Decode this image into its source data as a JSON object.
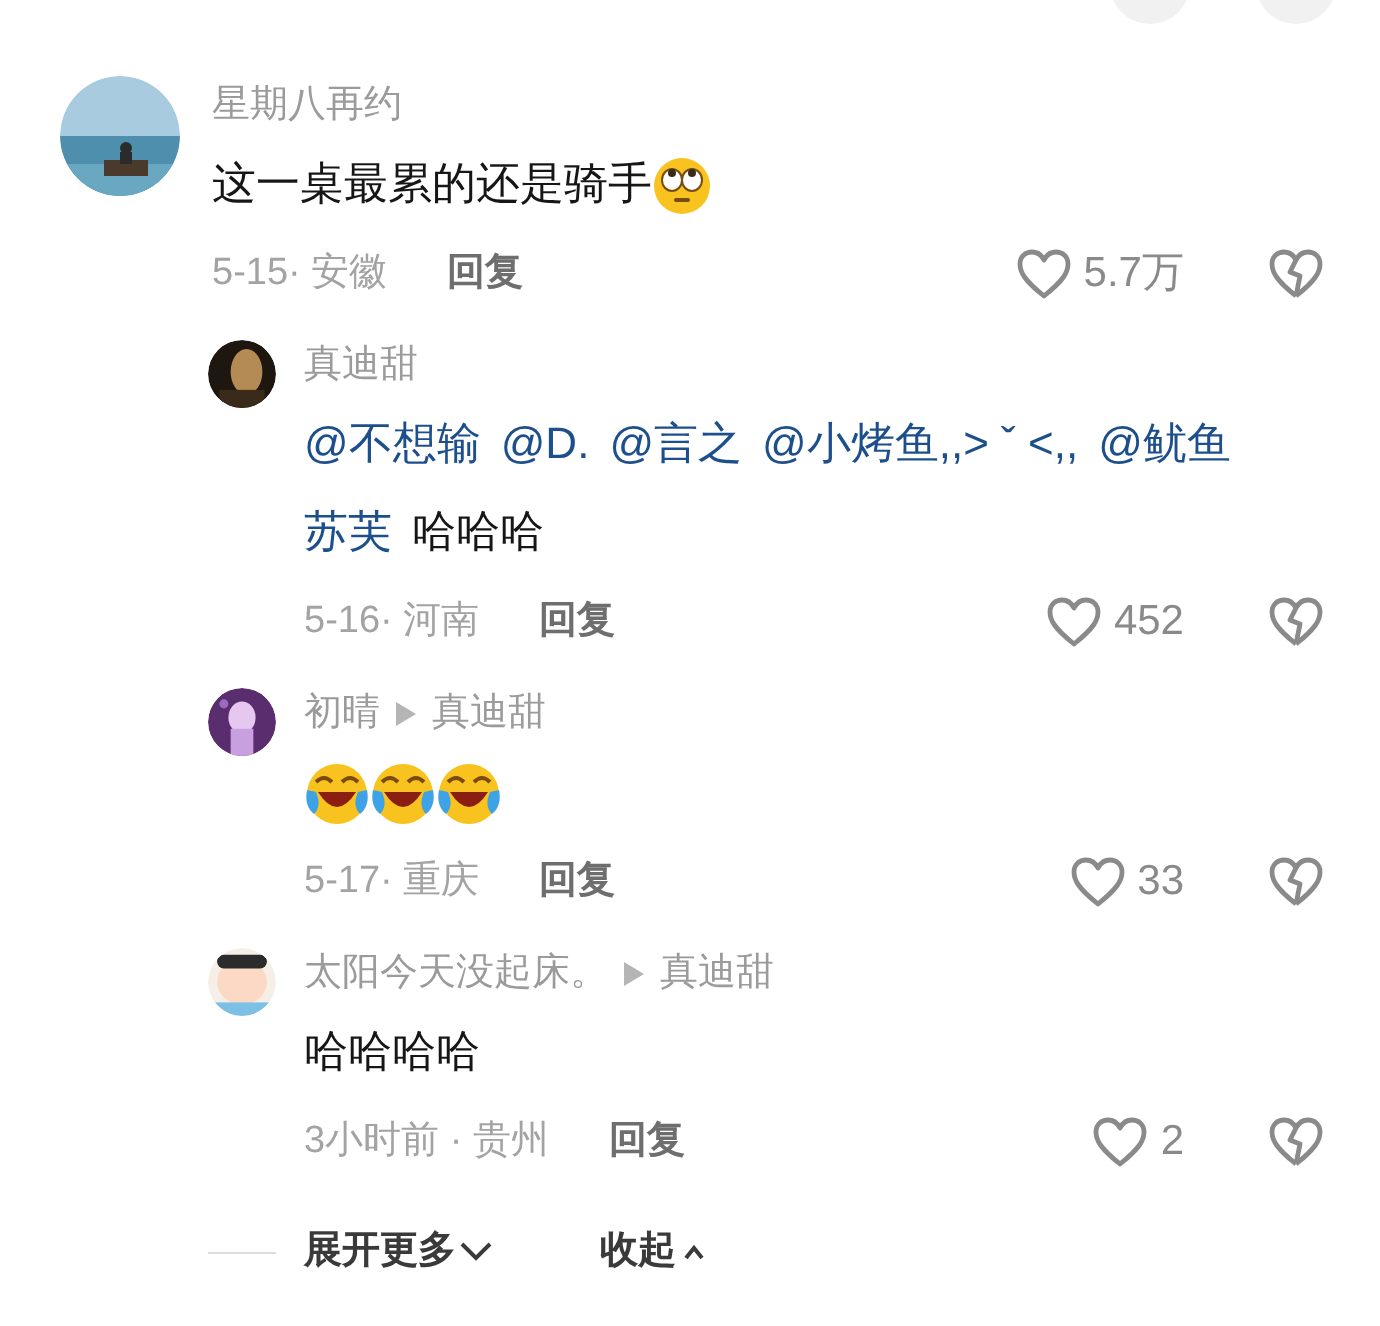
{
  "comments": [
    {
      "author": "星期八再约",
      "kind": "top",
      "body": [
        {
          "kind": "text",
          "text": "这一桌最累的还是骑手"
        },
        {
          "kind": "eyeroll"
        }
      ],
      "meta": "5-15· 安徽",
      "reply": "回复",
      "likes": "5.7万"
    },
    {
      "author": "真迪甜",
      "kind": "reply",
      "body": [
        {
          "kind": "mention",
          "text": "@不想输"
        },
        {
          "kind": "mention",
          "text": "@D."
        },
        {
          "kind": "mention",
          "text": "@言之"
        },
        {
          "kind": "mention",
          "text": "@小烤鱼,,> ˇ <,,"
        },
        {
          "kind": "mention",
          "text": "@鱿鱼"
        },
        {
          "kind": "mention",
          "text": "苏芙"
        },
        {
          "kind": "text",
          "text": "哈哈哈"
        }
      ],
      "meta": "5-16· 河南",
      "reply": "回复",
      "likes": "452"
    },
    {
      "author": "初晴",
      "reply_to": "真迪甜",
      "kind": "reply",
      "body": [
        {
          "kind": "laughcry"
        },
        {
          "kind": "laughcry"
        },
        {
          "kind": "laughcry"
        }
      ],
      "meta": "5-17· 重庆",
      "reply": "回复",
      "likes": "33"
    },
    {
      "author": "太阳今天没起床。",
      "reply_to": "真迪甜",
      "kind": "reply",
      "body": [
        {
          "kind": "text",
          "text": "哈哈哈哈"
        }
      ],
      "meta": "3小时前 · 贵州",
      "reply": "回复",
      "likes": "2"
    }
  ],
  "footer": {
    "expand": "展开更多",
    "collapse": "收起"
  }
}
